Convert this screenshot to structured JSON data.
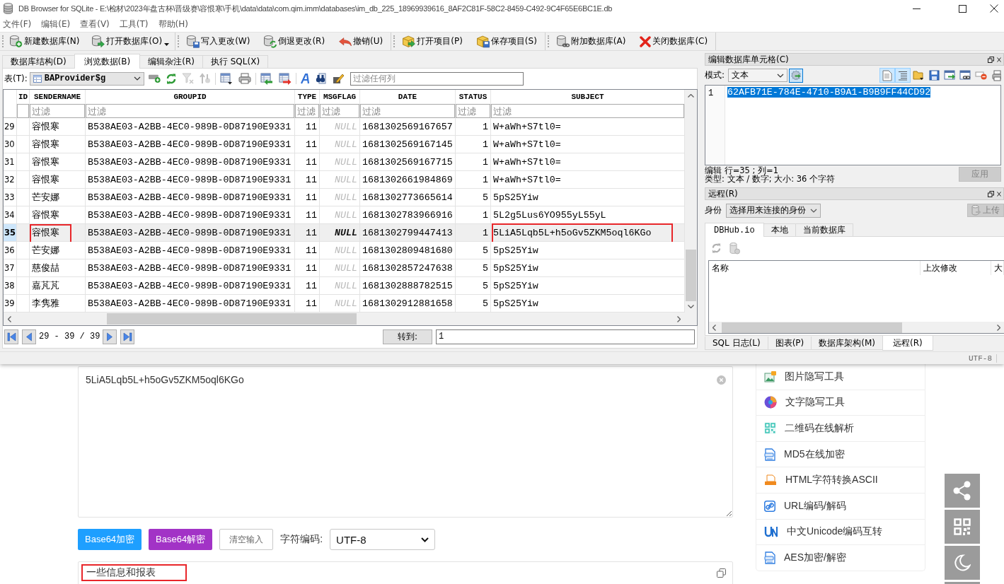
{
  "window": {
    "title": "DB Browser for SQLite - E:\\检材\\2023年盘古杯\\晋级赛\\容恨寒\\手机\\data\\data\\com.qim.imm\\databases\\im_db_225_18969939616_8AF2C81F-58C2-8459-C492-9C4F65E6BC1E.db"
  },
  "menu": [
    "文件(F)",
    "编辑(E)",
    "查看(V)",
    "工具(T)",
    "帮助(H)"
  ],
  "toolbar": [
    [
      {
        "label": "新建数据库(N)",
        "dropdown": false
      },
      {
        "label": "打开数据库(O)",
        "dropdown": true
      }
    ],
    [
      {
        "label": "写入更改(W)",
        "dropdown": false
      },
      {
        "label": "倒退更改(R)",
        "dropdown": false
      },
      {
        "label": "撤销(U)",
        "dropdown": false
      }
    ],
    [
      {
        "label": "打开项目(P)",
        "dropdown": false
      },
      {
        "label": "保存项目(S)",
        "dropdown": false
      }
    ],
    [
      {
        "label": "附加数据库(A)",
        "dropdown": false
      },
      {
        "label": "关闭数据库(C)",
        "dropdown": false
      }
    ]
  ],
  "tabs": [
    {
      "label": "数据库结构(D)",
      "selected": false
    },
    {
      "label": "浏览数据(B)",
      "selected": true
    },
    {
      "label": "编辑杂注(R)",
      "selected": false
    },
    {
      "label": "执行 SQL(X)",
      "selected": false
    }
  ],
  "browse": {
    "table_label": "表(T):",
    "table": "BAProvider$g",
    "tools": [
      [
        {
          "disabled": false
        },
        {
          "disabled": false
        },
        {
          "disabled": true
        },
        {
          "disabled": true
        }
      ],
      [
        {
          "disabled": false
        },
        {
          "disabled": false
        }
      ],
      [
        {
          "disabled": false
        },
        {
          "disabled": false
        }
      ],
      [
        {
          "disabled": false
        },
        {
          "disabled": false
        },
        {
          "disabled": false
        }
      ]
    ],
    "filter_placeholder": "过滤任何列",
    "columns": [
      {
        "name": "ID"
      },
      {
        "name": "SENDERNAME",
        "placeholder": "过滤"
      },
      {
        "name": "GROUPID",
        "placeholder": "过滤"
      },
      {
        "name": "TYPE",
        "placeholder": "过滤"
      },
      {
        "name": "MSGFLAG",
        "placeholder": "过滤"
      },
      {
        "name": "DATE",
        "placeholder": "过滤"
      },
      {
        "name": "STATUS",
        "placeholder": "过滤"
      },
      {
        "name": "SUBJECT",
        "placeholder": "过滤"
      }
    ],
    "rows": [
      {
        "no": "29",
        "sendername": "容恨寒",
        "groupid": "B538AE03-A2BB-4EC0-989B-0D87190E9331",
        "type": "11",
        "msgflag": "NULL",
        "date": "1681302569167657",
        "status": "1",
        "subject": "W+aWh+S7tl0=",
        "selected": false,
        "sendername_marked": false,
        "subject_marked": false
      },
      {
        "no": "30",
        "sendername": "容恨寒",
        "groupid": "B538AE03-A2BB-4EC0-989B-0D87190E9331",
        "type": "11",
        "msgflag": "NULL",
        "date": "1681302569167145",
        "status": "1",
        "subject": "W+aWh+S7tl0=",
        "selected": false,
        "sendername_marked": false,
        "subject_marked": false
      },
      {
        "no": "31",
        "sendername": "容恨寒",
        "groupid": "B538AE03-A2BB-4EC0-989B-0D87190E9331",
        "type": "11",
        "msgflag": "NULL",
        "date": "1681302569167715",
        "status": "1",
        "subject": "W+aWh+S7tl0=",
        "selected": false,
        "sendername_marked": false,
        "subject_marked": false
      },
      {
        "no": "32",
        "sendername": "容恨寒",
        "groupid": "B538AE03-A2BB-4EC0-989B-0D87190E9331",
        "type": "11",
        "msgflag": "NULL",
        "date": "1681302661984869",
        "status": "1",
        "subject": "W+aWh+S7tl0=",
        "selected": false,
        "sendername_marked": false,
        "subject_marked": false
      },
      {
        "no": "33",
        "sendername": "芒安娜",
        "groupid": "B538AE03-A2BB-4EC0-989B-0D87190E9331",
        "type": "11",
        "msgflag": "NULL",
        "date": "1681302773665614",
        "status": "5",
        "subject": "5pS25Yiw",
        "selected": false,
        "sendername_marked": false,
        "subject_marked": false
      },
      {
        "no": "34",
        "sendername": "容恨寒",
        "groupid": "B538AE03-A2BB-4EC0-989B-0D87190E9331",
        "type": "11",
        "msgflag": "NULL",
        "date": "1681302783966916",
        "status": "1",
        "subject": "5L2g5Lus6YO955yL55yL",
        "selected": false,
        "sendername_marked": false,
        "subject_marked": false
      },
      {
        "no": "35",
        "sendername": "容恨寒",
        "groupid": "B538AE03-A2BB-4EC0-989B-0D87190E9331",
        "type": "11",
        "msgflag": "NULL",
        "date": "1681302799447413",
        "status": "1",
        "subject": "5LiA5Lqb5L+h5oGv5ZKM5oql6KGo",
        "selected": true,
        "sendername_marked": true,
        "subject_marked": true
      },
      {
        "no": "36",
        "sendername": "芒安娜",
        "groupid": "B538AE03-A2BB-4EC0-989B-0D87190E9331",
        "type": "11",
        "msgflag": "NULL",
        "date": "1681302809481680",
        "status": "5",
        "subject": "5pS25Yiw",
        "selected": false,
        "sendername_marked": false,
        "subject_marked": false
      },
      {
        "no": "37",
        "sendername": "慈俊喆",
        "groupid": "B538AE03-A2BB-4EC0-989B-0D87190E9331",
        "type": "11",
        "msgflag": "NULL",
        "date": "1681302857247638",
        "status": "5",
        "subject": "5pS25Yiw",
        "selected": false,
        "sendername_marked": false,
        "subject_marked": false
      },
      {
        "no": "38",
        "sendername": "嘉芃芃",
        "groupid": "B538AE03-A2BB-4EC0-989B-0D87190E9331",
        "type": "11",
        "msgflag": "NULL",
        "date": "1681302888782515",
        "status": "5",
        "subject": "5pS25Yiw",
        "selected": false,
        "sendername_marked": false,
        "subject_marked": false
      },
      {
        "no": "39",
        "sendername": "李隽雅",
        "groupid": "B538AE03-A2BB-4EC0-989B-0D87190E9331",
        "type": "11",
        "msgflag": "NULL",
        "date": "1681302912881658",
        "status": "5",
        "subject": "5pS25Yiw",
        "selected": false,
        "sendername_marked": false,
        "subject_marked": false
      }
    ],
    "nav": {
      "range": "29 - 39 / 39",
      "goto_label": "转到:",
      "goto_value": "1"
    }
  },
  "cell_editor": {
    "title": "编辑数据库单元格(C)",
    "mode_label": "模式:",
    "mode": "文本",
    "mode_button_on": true,
    "tools": [
      {
        "on": true
      },
      {
        "on": true
      },
      {
        "on": false
      },
      {
        "on": false
      },
      {
        "on": false
      },
      {
        "on": false
      },
      {
        "on": false
      },
      {
        "on": false
      }
    ],
    "line_number": "1",
    "value": "62AFB71E-784E-4710-B9A1-B9B9FF44CD92",
    "value_selected": true,
    "position": "编辑 行=35 ; 列=1",
    "info": "类型: 文本 / 数字; 大小: 36 个字符",
    "apply": {
      "label": "应用",
      "disabled": true
    }
  },
  "remote": {
    "title": "远程(R)",
    "identity_label": "身份",
    "identity": "选择用来连接的身份",
    "upload": {
      "label": "上传",
      "disabled": true
    },
    "tabs": [
      {
        "label": "DBHub.io",
        "selected": true
      },
      {
        "label": "本地",
        "selected": false
      },
      {
        "label": "当前数据库",
        "selected": false
      }
    ],
    "tools": [
      {
        "disabled": true
      },
      {
        "disabled": true
      }
    ],
    "columns": [
      "名称",
      "上次修改",
      "大"
    ]
  },
  "dock_tabs": [
    {
      "label": "SQL 日志(L)",
      "selected": false
    },
    {
      "label": "图表(P)",
      "selected": false
    },
    {
      "label": "数据库架构(M)",
      "selected": false
    },
    {
      "label": "远程(R)",
      "selected": true
    }
  ],
  "status_bar": {
    "encoding": "UTF-8"
  },
  "web": {
    "input_value": "5LiA5Lqb5L+h5oGv5ZKM5oql6KGo",
    "buttons": [
      {
        "label": "Base64加密",
        "kind": "encode"
      },
      {
        "label": "Base64解密",
        "kind": "decode"
      },
      {
        "label": "清空输入",
        "kind": "clear"
      }
    ],
    "charset_label": "字符编码:",
    "charset": "UTF-8",
    "output_value": "一些信息和报表",
    "output_marked": true,
    "tools": [
      "图片隐写工具",
      "文字隐写工具",
      "二维码在线解析",
      "MD5在线加密",
      "HTML字符转换ASCII",
      "URL编码/解码",
      "中文Unicode编码互转",
      "AES加密/解密"
    ]
  }
}
